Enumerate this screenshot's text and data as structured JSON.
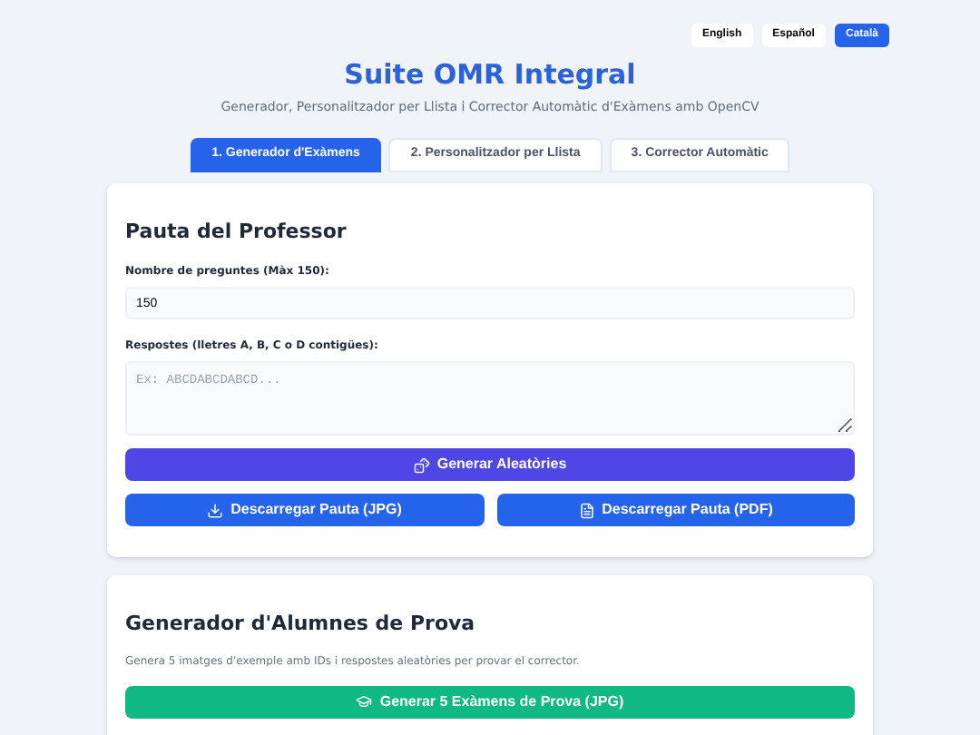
{
  "languages": [
    {
      "label": "English",
      "selected": false
    },
    {
      "label": "Español",
      "selected": false
    },
    {
      "label": "Català",
      "selected": true
    }
  ],
  "header": {
    "title": "Suite OMR Integral",
    "subtitle": "Generador, Personalitzador per Llista i Corrector Automàtic d'Exàmens amb OpenCV"
  },
  "tabs": [
    {
      "label": "1. Generador d'Exàmens",
      "selected": true
    },
    {
      "label": "2. Personalitzador per Llista",
      "selected": false
    },
    {
      "label": "3. Corrector Automàtic",
      "selected": false
    }
  ],
  "teacher_key": {
    "title": "Pauta del Professor",
    "questions_label": "Nombre de preguntes (Màx 150):",
    "questions_value": "150",
    "answers_label": "Respostes (lletres A, B, C o D contigües):",
    "answers_placeholder": "Ex: ABCDABCDABCD...",
    "buttons": [
      {
        "kind": "random",
        "label": "Generar Aleatòries"
      },
      {
        "kind": "jpg",
        "label": "Descarregar Pauta (JPG)"
      },
      {
        "kind": "pdf",
        "label": "Descarregar Pauta (PDF)"
      }
    ]
  },
  "test_students": {
    "title": "Generador d'Alumnes de Prova",
    "description": "Genera 5 imatges d'exemple amb IDs i respostes aleatòries per provar el corrector.",
    "button": "Generar 5 Exàmens de Prova (JPG)"
  }
}
